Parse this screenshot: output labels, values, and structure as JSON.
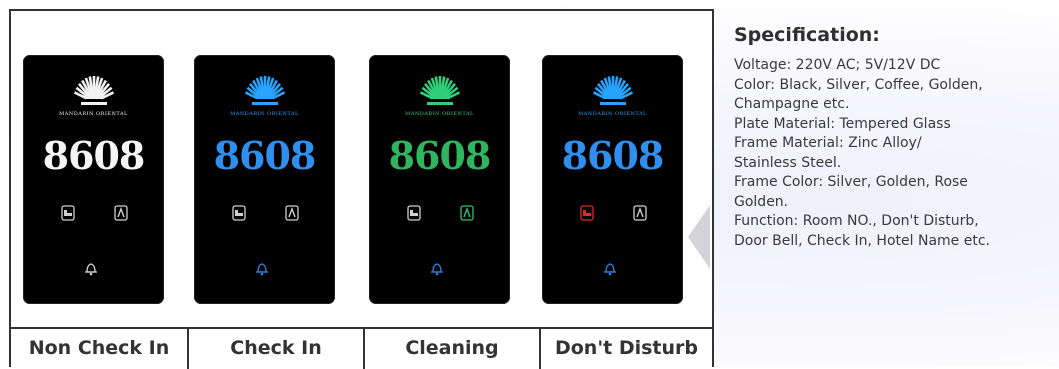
{
  "panels": [
    {
      "id": "non-check-in",
      "room": "8608",
      "hotel": "MANDARIN ORIENTAL",
      "logo_color": "#f2f2f2",
      "number_color": "#f5f5f5",
      "left_icon_color": "#d0d0d0",
      "right_icon_color": "#d0d0d0",
      "bell_icon_color": "#d0d0d0"
    },
    {
      "id": "check-in",
      "room": "8608",
      "hotel": "MANDARIN ORIENTAL",
      "logo_color": "#28a3ff",
      "number_color": "#2f8ff0",
      "left_icon_color": "#d0d0d0",
      "right_icon_color": "#d0d0d0",
      "bell_icon_color": "#2f7fe0"
    },
    {
      "id": "cleaning",
      "room": "8608",
      "hotel": "MANDARIN ORIENTAL",
      "logo_color": "#2fd07a",
      "number_color": "#2fb560",
      "left_icon_color": "#d0d0d0",
      "right_icon_color": "#35c06a",
      "bell_icon_color": "#2f7fe0"
    },
    {
      "id": "dont-disturb",
      "room": "8608",
      "hotel": "MANDARIN ORIENTAL",
      "logo_color": "#28a3ff",
      "number_color": "#2f8ff0",
      "left_icon_color": "#e02a2a",
      "right_icon_color": "#d0d0d0",
      "bell_icon_color": "#2f7fe0"
    }
  ],
  "labels": [
    "Non Check In",
    "Check In",
    "Cleaning",
    "Don't Disturb"
  ],
  "spec": {
    "title": "Specification:",
    "lines": [
      "Voltage: 220V AC; 5V/12V DC",
      "Color: Black, Silver, Coffee, Golden,",
      "Champagne etc.",
      "Plate Material: Tempered Glass",
      "Frame Material: Zinc Alloy/",
      "Stainless Steel.",
      "Frame Color: Silver, Golden, Rose",
      "Golden.",
      "Function: Room NO., Don't Disturb,",
      "Door Bell, Check In, Hotel Name etc."
    ]
  },
  "icons": {
    "logo": "fan-logo-icon",
    "left": "bed-icon",
    "right": "broom-icon",
    "bell": "bell-icon"
  }
}
